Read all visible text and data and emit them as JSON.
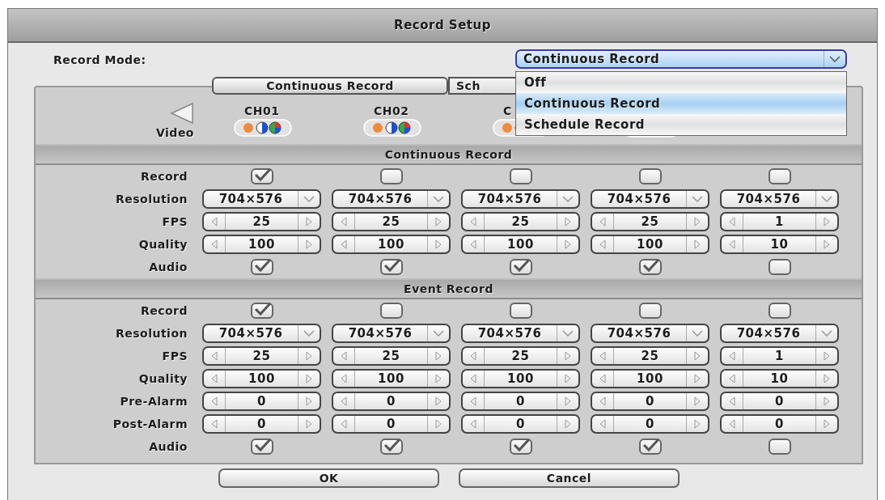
{
  "window": {
    "title": "Record Setup"
  },
  "record_mode": {
    "label": "Record Mode:",
    "value": "Continuous Record",
    "expanded": true,
    "options": [
      {
        "label": "Off",
        "selected": false
      },
      {
        "label": "Continuous Record",
        "selected": true
      },
      {
        "label": "Schedule Record",
        "selected": false
      }
    ]
  },
  "tabs": [
    {
      "label": "Continuous Record",
      "selected": true
    },
    {
      "label": "Sch",
      "selected": false
    }
  ],
  "video": {
    "label": "Video",
    "channels": [
      {
        "kind": "labeled",
        "label": "CH01"
      },
      {
        "kind": "labeled",
        "label": "CH02"
      },
      {
        "kind": "labeled",
        "label": "C"
      },
      {
        "kind": "unlabeled"
      }
    ]
  },
  "sections": [
    {
      "title": "Continuous Record",
      "rows": [
        {
          "label": "Record",
          "kind": "checkbox",
          "cells": [
            {
              "checked": true
            },
            {
              "checked": false
            },
            {
              "checked": false
            },
            {
              "checked": false
            },
            {
              "checked": false
            }
          ]
        },
        {
          "label": "Resolution",
          "kind": "select",
          "cells": [
            "704×576",
            "704×576",
            "704×576",
            "704×576",
            "704×576"
          ]
        },
        {
          "label": "FPS",
          "kind": "spinner",
          "cells": [
            "25",
            "25",
            "25",
            "25",
            "1"
          ]
        },
        {
          "label": "Quality",
          "kind": "spinner",
          "cells": [
            "100",
            "100",
            "100",
            "100",
            "10"
          ]
        },
        {
          "label": "Audio",
          "kind": "checkbox",
          "cells": [
            {
              "checked": true
            },
            {
              "checked": true
            },
            {
              "checked": true
            },
            {
              "checked": true
            },
            {
              "checked": false
            }
          ]
        }
      ]
    },
    {
      "title": "Event Record",
      "rows": [
        {
          "label": "Record",
          "kind": "checkbox",
          "cells": [
            {
              "checked": true
            },
            {
              "checked": false
            },
            {
              "checked": false
            },
            {
              "checked": false
            },
            {
              "checked": false
            }
          ]
        },
        {
          "label": "Resolution",
          "kind": "select",
          "cells": [
            "704×576",
            "704×576",
            "704×576",
            "704×576",
            "704×576"
          ]
        },
        {
          "label": "FPS",
          "kind": "spinner",
          "cells": [
            "25",
            "25",
            "25",
            "25",
            "1"
          ]
        },
        {
          "label": "Quality",
          "kind": "spinner",
          "cells": [
            "100",
            "100",
            "100",
            "100",
            "10"
          ]
        },
        {
          "label": "Pre-Alarm",
          "kind": "spinner",
          "cells": [
            "0",
            "0",
            "0",
            "0",
            "0"
          ]
        },
        {
          "label": "Post-Alarm",
          "kind": "spinner",
          "cells": [
            "0",
            "0",
            "0",
            "0",
            "0"
          ]
        },
        {
          "label": "Audio",
          "kind": "checkbox",
          "cells": [
            {
              "checked": true
            },
            {
              "checked": true
            },
            {
              "checked": true
            },
            {
              "checked": true
            },
            {
              "checked": false
            }
          ]
        }
      ]
    }
  ],
  "buttons": [
    "OK",
    "Cancel"
  ]
}
